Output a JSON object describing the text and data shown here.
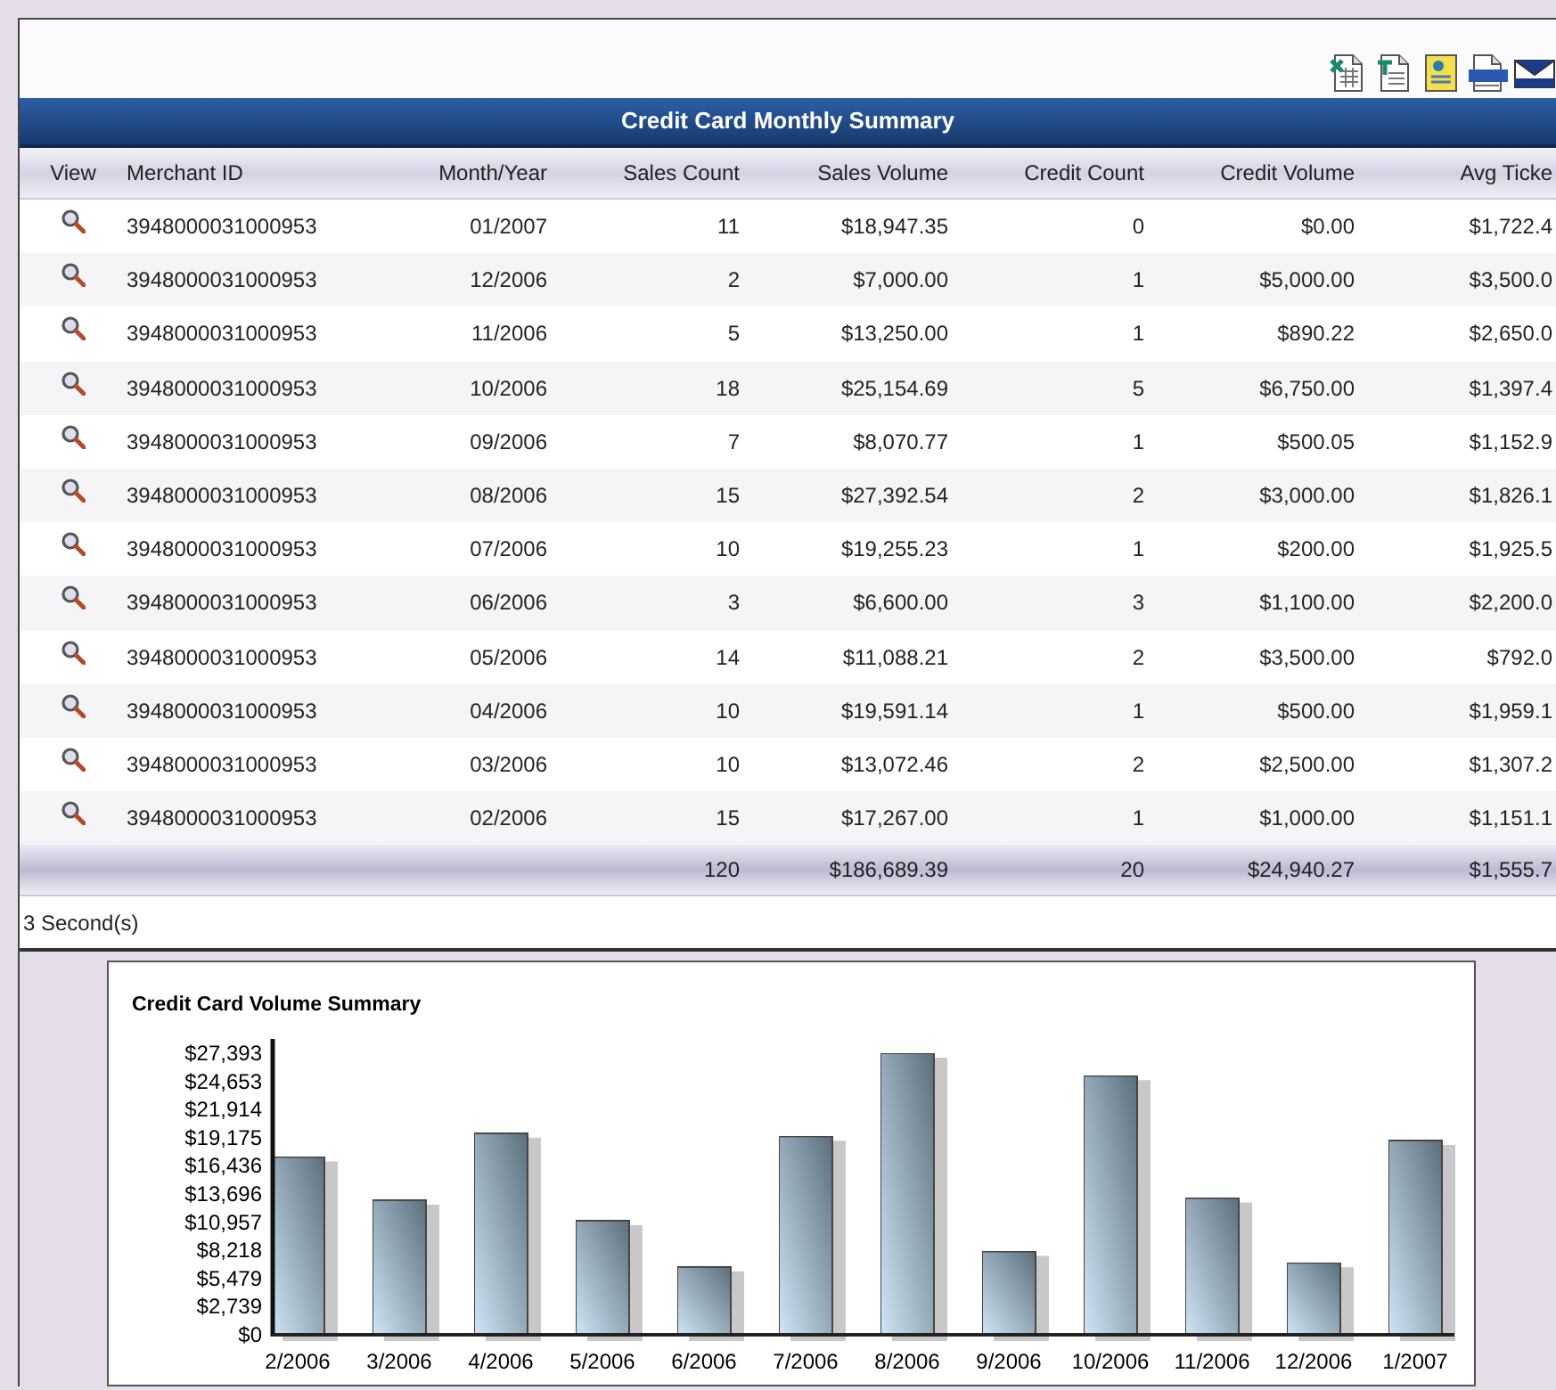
{
  "toolbar": [
    {
      "kind": "spreadsheet"
    },
    {
      "kind": "document"
    },
    {
      "kind": "notepad"
    },
    {
      "kind": "xml"
    },
    {
      "kind": "mail"
    }
  ],
  "table": {
    "title": "Credit Card Monthly Summary",
    "columns": [
      "View",
      "Merchant ID",
      "Month/Year",
      "Sales Count",
      "Sales Volume",
      "Credit Count",
      "Credit Volume",
      "Avg Ticke"
    ],
    "rows": [
      [
        "",
        "3948000031000953",
        "01/2007",
        "11",
        "$18,947.35",
        "0",
        "$0.00",
        "$1,722.4"
      ],
      [
        "",
        "3948000031000953",
        "12/2006",
        "2",
        "$7,000.00",
        "1",
        "$5,000.00",
        "$3,500.0"
      ],
      [
        "",
        "3948000031000953",
        "11/2006",
        "5",
        "$13,250.00",
        "1",
        "$890.22",
        "$2,650.0"
      ],
      [
        "",
        "3948000031000953",
        "10/2006",
        "18",
        "$25,154.69",
        "5",
        "$6,750.00",
        "$1,397.4"
      ],
      [
        "",
        "3948000031000953",
        "09/2006",
        "7",
        "$8,070.77",
        "1",
        "$500.05",
        "$1,152.9"
      ],
      [
        "",
        "3948000031000953",
        "08/2006",
        "15",
        "$27,392.54",
        "2",
        "$3,000.00",
        "$1,826.1"
      ],
      [
        "",
        "3948000031000953",
        "07/2006",
        "10",
        "$19,255.23",
        "1",
        "$200.00",
        "$1,925.5"
      ],
      [
        "",
        "3948000031000953",
        "06/2006",
        "3",
        "$6,600.00",
        "3",
        "$1,100.00",
        "$2,200.0"
      ],
      [
        "",
        "3948000031000953",
        "05/2006",
        "14",
        "$11,088.21",
        "2",
        "$3,500.00",
        "$792.0"
      ],
      [
        "",
        "3948000031000953",
        "04/2006",
        "10",
        "$19,591.14",
        "1",
        "$500.00",
        "$1,959.1"
      ],
      [
        "",
        "3948000031000953",
        "03/2006",
        "10",
        "$13,072.46",
        "2",
        "$2,500.00",
        "$1,307.2"
      ],
      [
        "",
        "3948000031000953",
        "02/2006",
        "15",
        "$17,267.00",
        "1",
        "$1,000.00",
        "$1,151.1"
      ]
    ],
    "totals": [
      "120",
      "$186,689.39",
      "20",
      "$24,940.27",
      "$1,555.7"
    ]
  },
  "timing": "3 Second(s)",
  "chart_data": {
    "type": "bar",
    "title": "Credit Card Volume Summary",
    "categories": [
      "2/2006",
      "3/2006",
      "4/2006",
      "5/2006",
      "6/2006",
      "7/2006",
      "8/2006",
      "9/2006",
      "10/2006",
      "11/2006",
      "12/2006",
      "1/2007"
    ],
    "values": [
      17300,
      13100,
      19600,
      11100,
      6600,
      19300,
      27390,
      8100,
      25200,
      13300,
      7000,
      18900
    ],
    "ylim": [
      0,
      27393
    ],
    "yticks": [
      {
        "value": 0,
        "label": "$0"
      },
      {
        "value": 2739,
        "label": "$2,739"
      },
      {
        "value": 5479,
        "label": "$5,479"
      },
      {
        "value": 8218,
        "label": "$8,218"
      },
      {
        "value": 10957,
        "label": "$10,957"
      },
      {
        "value": 13696,
        "label": "$13,696"
      },
      {
        "value": 16436,
        "label": "$16,436"
      },
      {
        "value": 19175,
        "label": "$19,175"
      },
      {
        "value": 21914,
        "label": "$21,914"
      },
      {
        "value": 24653,
        "label": "$24,653"
      },
      {
        "value": 27393,
        "label": "$27,393"
      }
    ]
  }
}
